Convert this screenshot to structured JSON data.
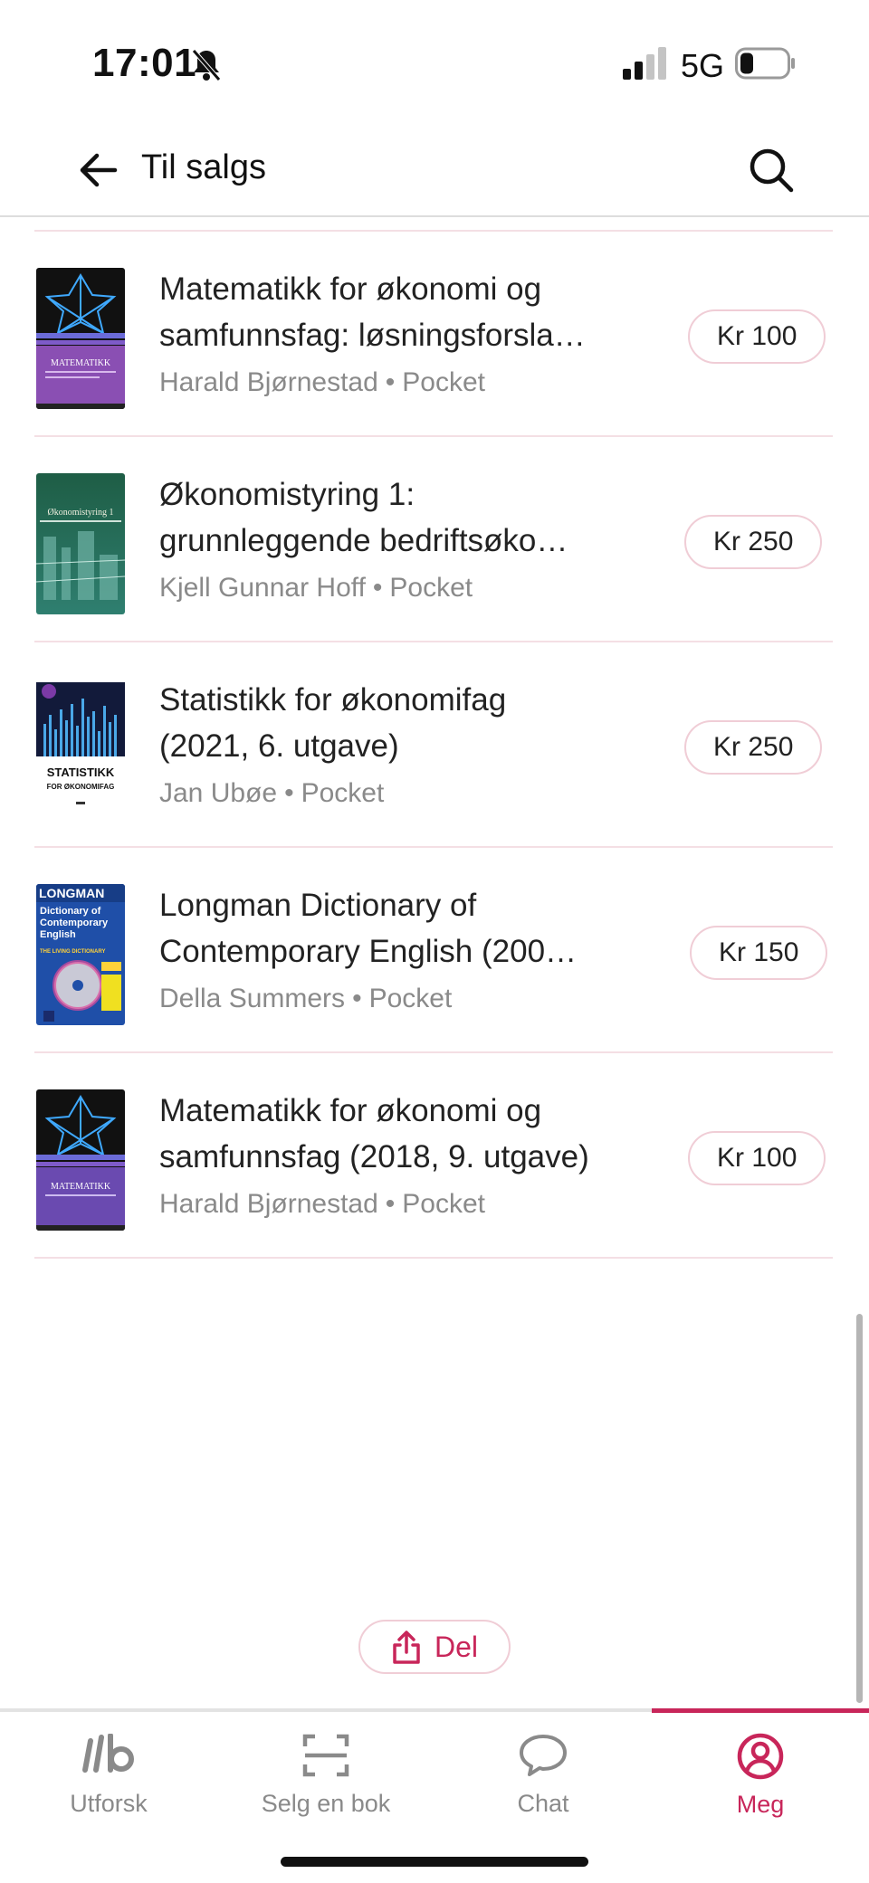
{
  "status_bar": {
    "time": "17:01",
    "network": "5G"
  },
  "header": {
    "title": "Til salgs"
  },
  "listings": [
    {
      "title_line1": "Matematikk for økonomi og",
      "title_line2": "samfunnsfag: løsningsforsla…",
      "author": "Harald Bjørnestad",
      "format": "Pocket",
      "price": "Kr 100"
    },
    {
      "title_line1": "Økonomistyring 1:",
      "title_line2": "grunnleggende bedriftsøko…",
      "author": "Kjell Gunnar Hoff",
      "format": "Pocket",
      "price": "Kr 250"
    },
    {
      "title_line1": "Statistikk for økonomifag",
      "title_line2": "(2021, 6. utgave)",
      "author": "Jan Ubøe",
      "format": "Pocket",
      "price": "Kr 250"
    },
    {
      "title_line1": "Longman Dictionary of",
      "title_line2": "Contemporary English (200…",
      "author": "Della Summers",
      "format": "Pocket",
      "price": "Kr 150"
    },
    {
      "title_line1": "Matematikk for økonomi og",
      "title_line2": "samfunnsfag (2018, 9. utgave)",
      "author": "Harald Bjørnestad",
      "format": "Pocket",
      "price": "Kr 100"
    }
  ],
  "covers": {
    "matematikk": {
      "label": "MATEMATIKK"
    },
    "okonomistyring": {
      "label": "Økonomistyring 1"
    },
    "statistikk": {
      "label1": "STATISTIKK",
      "label2": "FOR ØKONOMIFAG"
    },
    "longman": {
      "brand": "LONGMAN",
      "line1": "Dictionary of",
      "line2": "Contemporary",
      "line3": "English",
      "tag": "THE LIVING DICTIONARY"
    }
  },
  "share": {
    "label": "Del"
  },
  "tabs": [
    {
      "label": "Utforsk",
      "icon": "logo-ib-icon"
    },
    {
      "label": "Selg en bok",
      "icon": "scan-icon"
    },
    {
      "label": "Chat",
      "icon": "chat-bubble-icon"
    },
    {
      "label": "Meg",
      "icon": "user-circle-icon",
      "active": true
    }
  ],
  "colors": {
    "accent": "#c8265a",
    "divider": "#f4dfe4",
    "muted": "#8a8a8a"
  }
}
